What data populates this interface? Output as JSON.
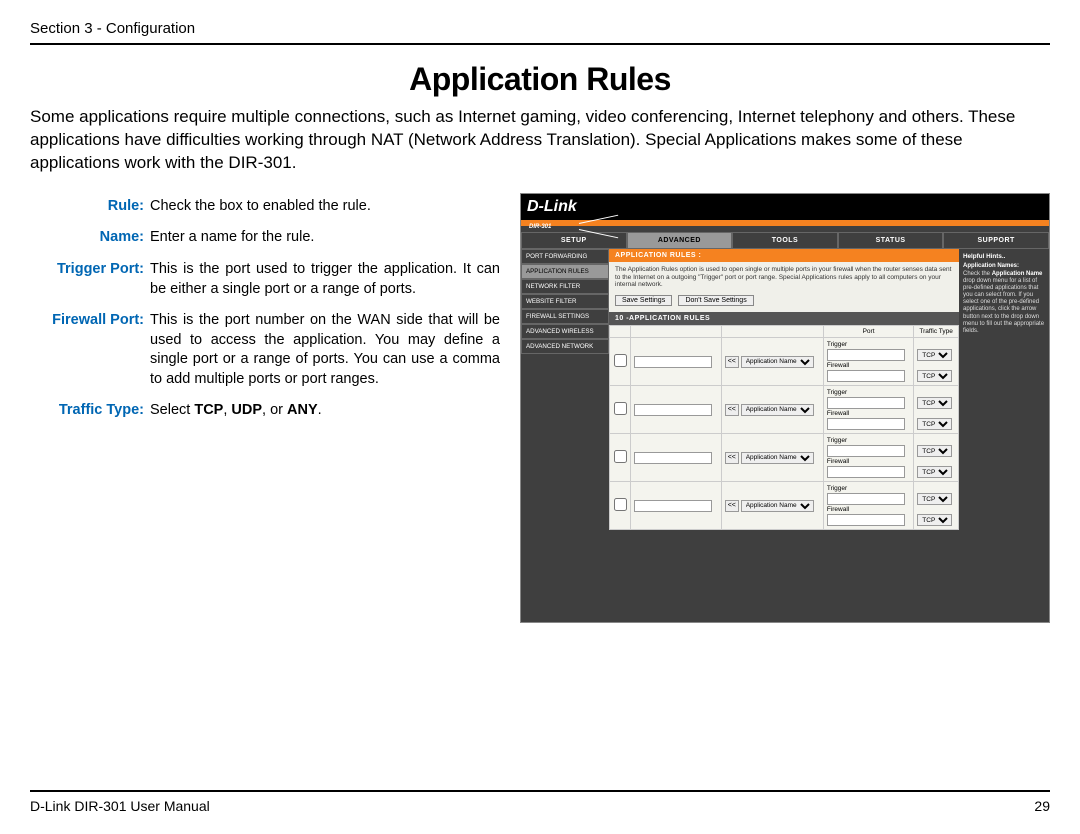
{
  "header": {
    "section": "Section 3 - Configuration"
  },
  "title": "Application Rules",
  "intro": "Some applications require multiple connections, such as Internet gaming, video conferencing, Internet telephony and others. These applications have difficulties working through NAT (Network Address Translation). Special Applications makes some of these applications work with the DIR-301.",
  "defs": [
    {
      "term": "Rule:",
      "val": "Check the box to enabled the rule."
    },
    {
      "term": "Name:",
      "val": "Enter a name for the rule."
    },
    {
      "term": "Trigger Port:",
      "val": "This is the port used to trigger the application. It can be either a single port or a range of ports."
    },
    {
      "term": "Firewall Port:",
      "val": "This is the port number on the WAN side that will be used to access the application. You may define a single port or a range of ports. You can use a comma to add multiple ports or port ranges."
    },
    {
      "term": "Traffic Type:",
      "val_html": "Select <b>TCP</b>, <b>UDP</b>, or <b>ANY</b>."
    }
  ],
  "screenshot": {
    "brand": "D-Link",
    "device": "DIR-301",
    "tabs": [
      "SETUP",
      "ADVANCED",
      "TOOLS",
      "STATUS",
      "SUPPORT"
    ],
    "active_tab": 1,
    "sidebar": [
      "PORT FORWARDING",
      "APPLICATION RULES",
      "NETWORK FILTER",
      "WEBSITE FILTER",
      "FIREWALL SETTINGS",
      "ADVANCED WIRELESS",
      "ADVANCED NETWORK"
    ],
    "sidebar_sel": 1,
    "section_title": "APPLICATION RULES :",
    "description": "The Application Rules option is used to open single or multiple ports in your firewall when the router senses data sent to the Internet on a outgoing \"Trigger\" port or port range. Special Applications rules apply to all computers on your internal network.",
    "buttons": {
      "save": "Save Settings",
      "dont_save": "Don't Save Settings"
    },
    "rules_header": "10 -APPLICATION RULES",
    "col_port": "Port",
    "col_traffic": "Traffic Type",
    "row_labels": {
      "trigger": "Trigger",
      "firewall": "Firewall"
    },
    "app_name_btn": "<<",
    "app_name_select": "Application Name",
    "traffic_select": "TCP",
    "rows": 4,
    "hints": {
      "title": "Helpful Hints..",
      "body_html": "<b>Application Names:</b><br>Check the <b>Application Name</b> drop down menu for a list of pre-defined applications that you can select from. If you select one of the pre-defined applications, click the arrow button next to the drop down menu to fill out the appropriate fields."
    }
  },
  "footer": {
    "left": "D-Link DIR-301 User Manual",
    "right": "29"
  }
}
